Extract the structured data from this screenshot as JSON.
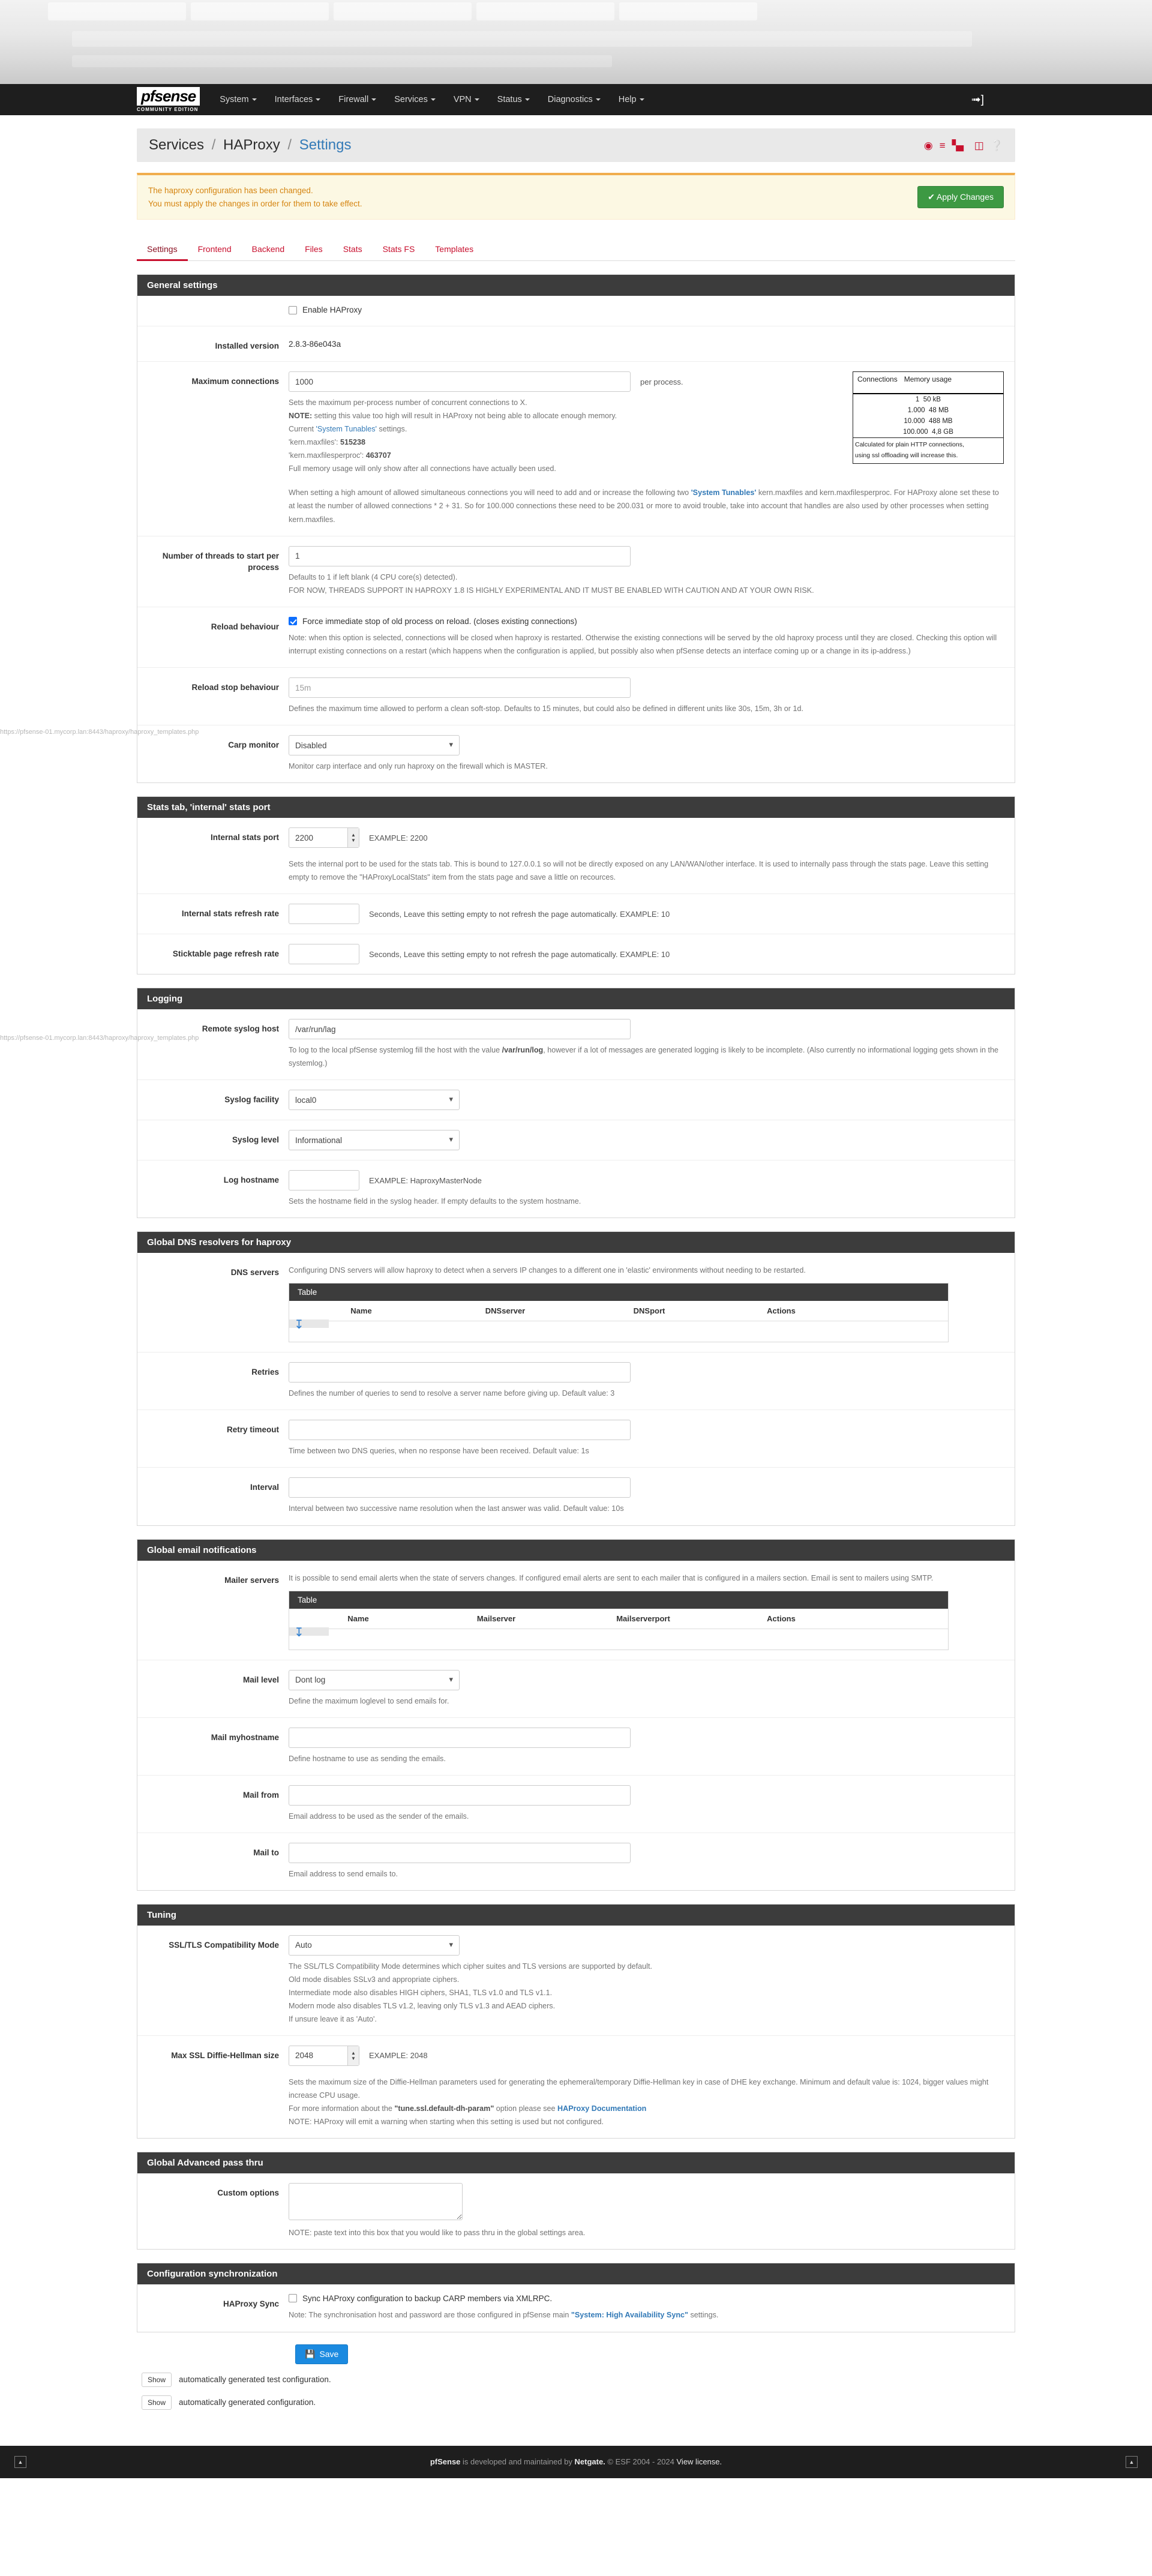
{
  "navbar": {
    "brand": "pfsense",
    "brand_sub": "COMMUNITY EDITION",
    "items": [
      "System",
      "Interfaces",
      "Firewall",
      "Services",
      "VPN",
      "Status",
      "Diagnostics",
      "Help"
    ],
    "logout_icon": "logout-icon"
  },
  "breadcrumb": {
    "root": "Services",
    "section": "HAProxy",
    "page": "Settings",
    "icons": [
      "play-circle-icon",
      "sliders-icon",
      "chart-icon",
      "list-icon",
      "help-circle-icon"
    ]
  },
  "alert": {
    "line1": "The haproxy configuration has been changed.",
    "line2": "You must apply the changes in order for them to take effect.",
    "apply_label": "Apply Changes",
    "apply_color": "#3d9943"
  },
  "tabs": [
    {
      "label": "Settings",
      "active": true
    },
    {
      "label": "Frontend",
      "active": false
    },
    {
      "label": "Backend",
      "active": false
    },
    {
      "label": "Files",
      "active": false
    },
    {
      "label": "Stats",
      "active": false
    },
    {
      "label": "Stats FS",
      "active": false
    },
    {
      "label": "Templates",
      "active": false
    }
  ],
  "general": {
    "title": "General settings",
    "enable_label": "Enable HAProxy",
    "enable_checked": false,
    "installed_version_label": "Installed version",
    "installed_version_value": "2.8.3-86e043a",
    "maxconn_label": "Maximum connections",
    "maxconn_value": "1000",
    "maxconn_suffix": "per process.",
    "maxconn_help_1": "Sets the maximum per-process number of concurrent connections to X.",
    "maxconn_help_note_bold": "NOTE:",
    "maxconn_help_note": " setting this value too high will result in HAProxy not being able to allocate enough memory.",
    "maxconn_help_current_pre": "Current ",
    "maxconn_help_current_link": "'System Tunables'",
    "maxconn_help_current_post": " settings.",
    "maxconn_kern_maxfiles_key": "'kern.maxfiles': ",
    "maxconn_kern_maxfiles_val": "515238",
    "maxconn_kern_maxfilesperproc_key": "'kern.maxfilesperproc': ",
    "maxconn_kern_maxfilesperproc_val": "463707",
    "maxconn_help_full": "Full memory usage will only show after all connections have actually been used.",
    "maxconn_help_tunables_a": "When setting a high amount of allowed simultaneous connections you will need to add and or increase the following two ",
    "maxconn_help_tunables_link": "'System Tunables'",
    "maxconn_help_tunables_b": " kern.maxfiles and kern.maxfilesperproc. For HAProxy alone set these to at least the number of allowed connections * 2 + 31. So for 100.000 connections these need to be 200.031 or more to avoid trouble, take into account that handles are also used by other processes when setting kern.maxfiles.",
    "memtable": {
      "col_connections": "Connections",
      "col_memory": "Memory usage",
      "rows": [
        {
          "connections": "1",
          "memory": "50 kB"
        },
        {
          "connections": "1.000",
          "memory": "48 MB"
        },
        {
          "connections": "10.000",
          "memory": "488 MB"
        },
        {
          "connections": "100.000",
          "memory": "4,8 GB"
        }
      ],
      "note_line1": "Calculated for plain HTTP connections,",
      "note_line2": "using ssl offloading will increase this."
    },
    "threads_label": "Number of threads to start per process",
    "threads_value": "1",
    "threads_help_1": "Defaults to 1 if left blank (4 CPU core(s) detected).",
    "threads_help_2": "FOR NOW, THREADS SUPPORT IN HAPROXY 1.8 IS HIGHLY EXPERIMENTAL AND IT MUST BE ENABLED WITH CAUTION AND AT YOUR OWN RISK.",
    "reload_label": "Reload behaviour",
    "reload_checkbox": "Force immediate stop of old process on reload. (closes existing connections)",
    "reload_checked": true,
    "reload_help": "Note: when this option is selected, connections will be closed when haproxy is restarted. Otherwise the existing connections will be served by the old haproxy process until they are closed. Checking this option will interrupt existing connections on a restart (which happens when the configuration is applied, but possibly also when pfSense detects an interface coming up or a change in its ip-address.)",
    "reloadstop_label": "Reload stop behaviour",
    "reloadstop_placeholder": "15m",
    "reloadstop_value": "",
    "reloadstop_help": "Defines the maximum time allowed to perform a clean soft-stop. Defaults to 15 minutes, but could also be defined in different units like 30s, 15m, 3h or 1d.",
    "carp_label": "Carp monitor",
    "carp_value": "Disabled",
    "carp_options": [
      "Disabled"
    ],
    "carp_help": "Monitor carp interface and only run haproxy on the firewall which is MASTER."
  },
  "stats": {
    "title": "Stats tab, 'internal' stats port",
    "port_label": "Internal stats port",
    "port_value": "2200",
    "port_example": "EXAMPLE: 2200",
    "port_help": "Sets the internal port to be used for the stats tab. This is bound to 127.0.0.1 so will not be directly exposed on any LAN/WAN/other interface. It is used to internally pass through the stats page. Leave this setting empty to remove the \"HAProxyLocalStats\" item from the stats page and save a little on recources.",
    "refresh_label": "Internal stats refresh rate",
    "refresh_value": "",
    "refresh_help": "Seconds, Leave this setting empty to not refresh the page automatically. EXAMPLE: 10",
    "sticktable_label": "Sticktable page refresh rate",
    "sticktable_value": "",
    "sticktable_help": "Seconds, Leave this setting empty to not refresh the page automatically. EXAMPLE: 10"
  },
  "logging": {
    "title": "Logging",
    "remote_label": "Remote syslog host",
    "remote_value": "/var/run/lag",
    "remote_help_a": "To log to the local pfSense systemlog fill the host with the value ",
    "remote_help_b": "/var/run/log",
    "remote_help_c": ", however if a lot of messages are generated logging is likely to be incomplete. (Also currently no informational logging gets shown in the systemlog.)",
    "facility_label": "Syslog facility",
    "facility_value": "local0",
    "facility_options": [
      "local0"
    ],
    "level_label": "Syslog level",
    "level_value": "Informational",
    "level_options": [
      "Informational"
    ],
    "hostname_label": "Log hostname",
    "hostname_value": "",
    "hostname_example": "EXAMPLE: HaproxyMasterNode",
    "hostname_help": "Sets the hostname field in the syslog header. If empty defaults to the system hostname."
  },
  "dns": {
    "title": "Global DNS resolvers for haproxy",
    "servers_label": "DNS servers",
    "servers_help": "Configuring DNS servers will allow haproxy to detect when a servers IP changes to a different one in 'elastic' environments without needing to be restarted.",
    "table_title": "Table",
    "table_columns": [
      "Name",
      "DNSserver",
      "DNSport",
      "Actions"
    ],
    "table_rows": [],
    "retries_label": "Retries",
    "retries_value": "",
    "retries_help": "Defines the number of queries to send to resolve a server name before giving up. Default value: 3",
    "retry_timeout_label": "Retry timeout",
    "retry_timeout_value": "",
    "retry_timeout_help": "Time between two DNS queries, when no response have been received. Default value: 1s",
    "interval_label": "Interval",
    "interval_value": "",
    "interval_help": "Interval between two successive name resolution when the last answer was valid. Default value: 10s"
  },
  "email": {
    "title": "Global email notifications",
    "mailer_label": "Mailer servers",
    "mailer_help": "It is possible to send email alerts when the state of servers changes. If configured email alerts are sent to each mailer that is configured in a mailers section. Email is sent to mailers using SMTP.",
    "table_title": "Table",
    "table_columns": [
      "Name",
      "Mailserver",
      "Mailserverport",
      "Actions"
    ],
    "table_rows": [],
    "mail_level_label": "Mail level",
    "mail_level_value": "Dont log",
    "mail_level_options": [
      "Dont log"
    ],
    "mail_level_help": "Define the maximum loglevel to send emails for.",
    "myhostname_label": "Mail myhostname",
    "myhostname_value": "",
    "myhostname_help": "Define hostname to use as sending the emails.",
    "mailfrom_label": "Mail from",
    "mailfrom_value": "",
    "mailfrom_help": "Email address to be used as the sender of the emails.",
    "mailto_label": "Mail to",
    "mailto_value": "",
    "mailto_help": "Email address to send emails to."
  },
  "tuning": {
    "title": "Tuning",
    "ssl_mode_label": "SSL/TLS Compatibility Mode",
    "ssl_mode_value": "Auto",
    "ssl_mode_options": [
      "Auto"
    ],
    "ssl_help_1": "The SSL/TLS Compatibility Mode determines which cipher suites and TLS versions are supported by default.",
    "ssl_help_2": "Old mode disables SSLv3 and appropriate ciphers.",
    "ssl_help_3": "Intermediate mode also disables HIGH ciphers, SHA1, TLS v1.0 and TLS v1.1.",
    "ssl_help_4": "Modern mode also disables TLS v1.2, leaving only TLS v1.3 and AEAD ciphers.",
    "ssl_help_5": "If unsure leave it as 'Auto'.",
    "dh_label": "Max SSL Diffie-Hellman size",
    "dh_value": "2048",
    "dh_example": "EXAMPLE: 2048",
    "dh_help_1": "Sets the maximum size of the Diffie-Hellman parameters used for generating the ephemeral/temporary Diffie-Hellman key in case of DHE key exchange. Minimum and default value is: 1024, bigger values might increase CPU usage.",
    "dh_help_2_a": "For more information about the ",
    "dh_help_2_bold": "\"tune.ssl.default-dh-param\"",
    "dh_help_2_b": " option please see ",
    "dh_help_2_link": "HAProxy Documentation",
    "dh_help_3": "NOTE: HAProxy will emit a warning when starting when this setting is used but not configured."
  },
  "advanced": {
    "title": "Global Advanced pass thru",
    "custom_label": "Custom options",
    "custom_value": "",
    "custom_help": "NOTE: paste text into this box that you would like to pass thru in the global settings area."
  },
  "sync": {
    "title": "Configuration synchronization",
    "label": "HAProxy Sync",
    "checkbox": "Sync HAProxy configuration to backup CARP members via XMLRPC.",
    "checked": false,
    "help_a": "Note: The synchronisation host and password are those configured in pfSense main ",
    "help_link": "\"System: High Availability Sync\"",
    "help_b": " settings."
  },
  "actions": {
    "save_label": "Save",
    "save_icon": "floppy-disk-icon",
    "show_label": "Show",
    "show_test_text": "automatically generated test configuration.",
    "show_conf_text": "automatically generated configuration."
  },
  "footer": {
    "brand": "pfSense",
    "mid": " is developed and maintained by ",
    "netgate": "Netgate.",
    "copyright": " © ESF 2004 - 2024 ",
    "license": "View license.",
    "left_icon": "collapse-icon",
    "right_icon": "expand-icon"
  },
  "browser_ghosts": {
    "url_templates": "https://pfsense-01.mycorp.lan:8443/haproxy/haproxy_templates.php",
    "url_templates_2": "https://pfsense-01.mycorp.lan:8443/haproxy/haproxy_templates.php"
  }
}
